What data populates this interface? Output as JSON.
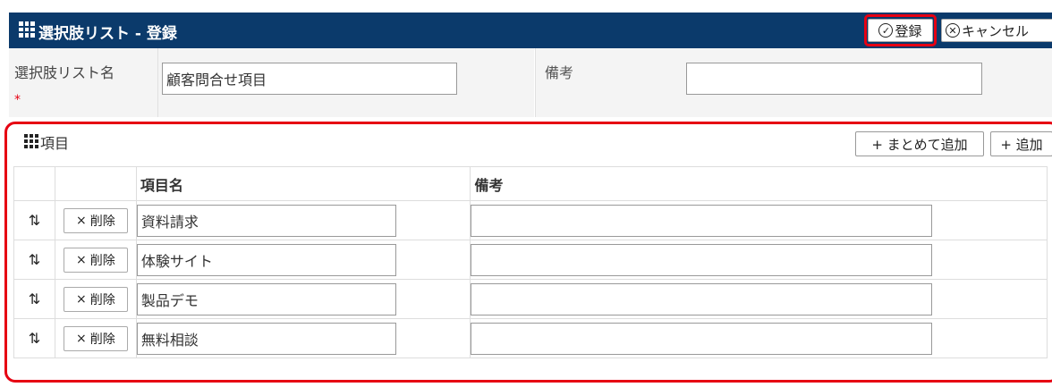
{
  "header": {
    "title": "選択肢リスト - 登録",
    "register_label": "登録",
    "cancel_label": "キャンセル"
  },
  "form": {
    "name_label": "選択肢リスト名",
    "required_mark": "*",
    "name_value": "顧客問合せ項目",
    "note_label": "備考",
    "note_value": ""
  },
  "items_section": {
    "title": "項目",
    "bulk_add_label": "+ まとめて追加",
    "add_label": "+ 追加",
    "columns": [
      "項目名",
      "備考"
    ],
    "delete_label": "削除",
    "rows": [
      {
        "name": "資料請求",
        "note": ""
      },
      {
        "name": "体験サイト",
        "note": ""
      },
      {
        "name": "製品デモ",
        "note": ""
      },
      {
        "name": "無料相談",
        "note": ""
      }
    ]
  }
}
